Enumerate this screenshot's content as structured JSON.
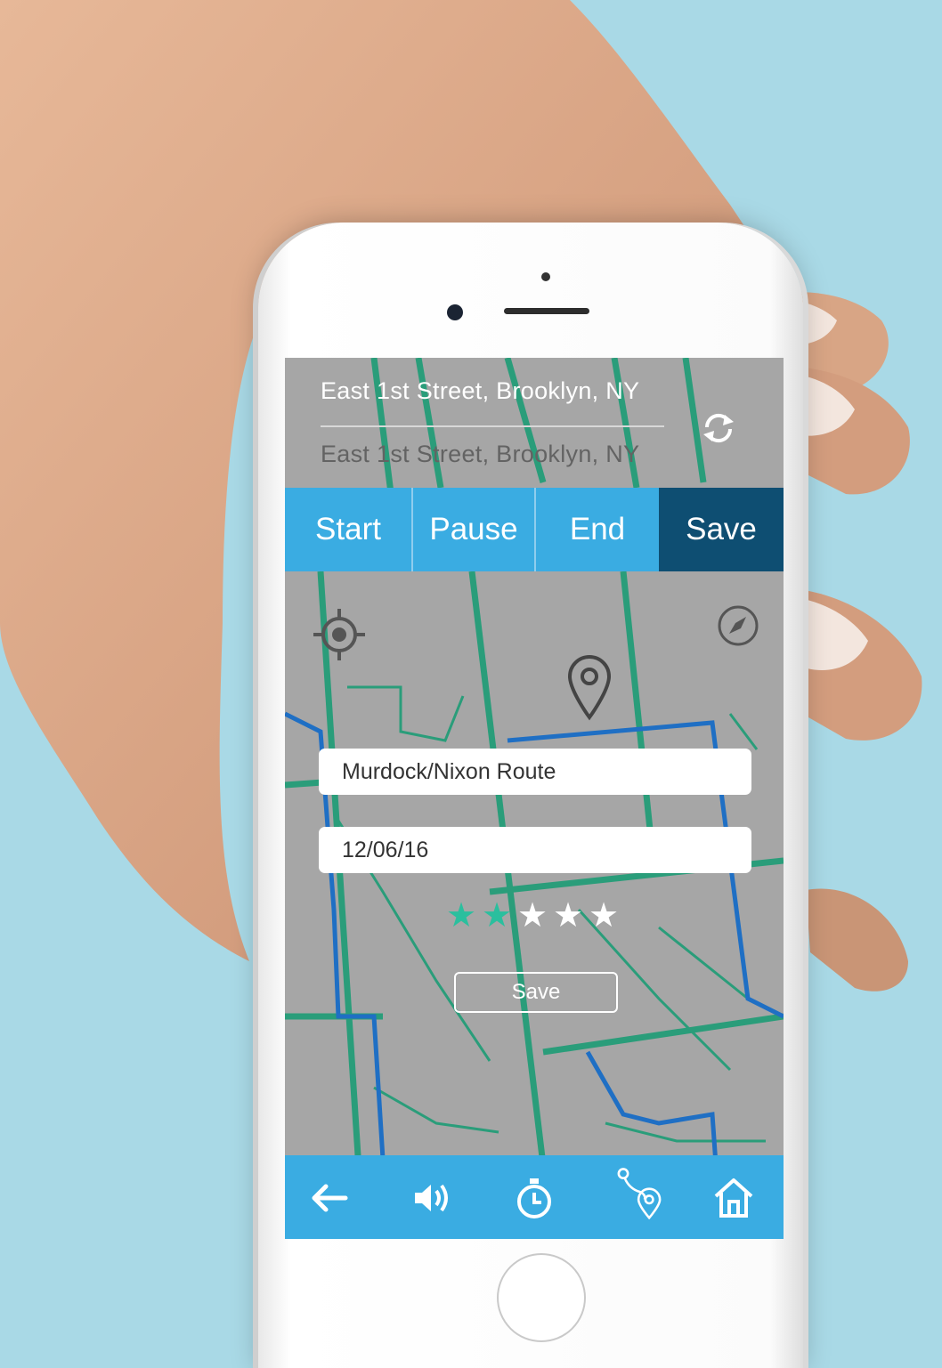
{
  "route": {
    "from": "East 1st Street, Brooklyn, NY",
    "to": "East 1st Street, Brooklyn, NY",
    "swap_icon": "refresh-swap-icon"
  },
  "tabs": [
    "Start",
    "Pause",
    "End",
    "Save"
  ],
  "active_tab": "Save",
  "map_controls": {
    "locate_icon": "crosshair-target-icon",
    "compass_icon": "compass-icon",
    "pin_icon": "location-pin-icon"
  },
  "form": {
    "route_name": "Murdock/Nixon Route",
    "date": "12/06/16",
    "rating": 2,
    "rating_max": 5,
    "save_label": "Save"
  },
  "bottom_nav": [
    {
      "icon": "back-arrow-icon"
    },
    {
      "icon": "speaker-volume-icon"
    },
    {
      "icon": "stopwatch-icon"
    },
    {
      "icon": "route-pin-icon"
    },
    {
      "icon": "home-icon"
    }
  ],
  "colors": {
    "background": "#a9d9e6",
    "accent_blue": "#3aace2",
    "active_tab": "#0e4e72",
    "map_gray": "#a6a6a6",
    "map_road_green": "#2a9d7a",
    "map_route_blue": "#1f6fc4",
    "star_filled": "#2bbf9e"
  }
}
